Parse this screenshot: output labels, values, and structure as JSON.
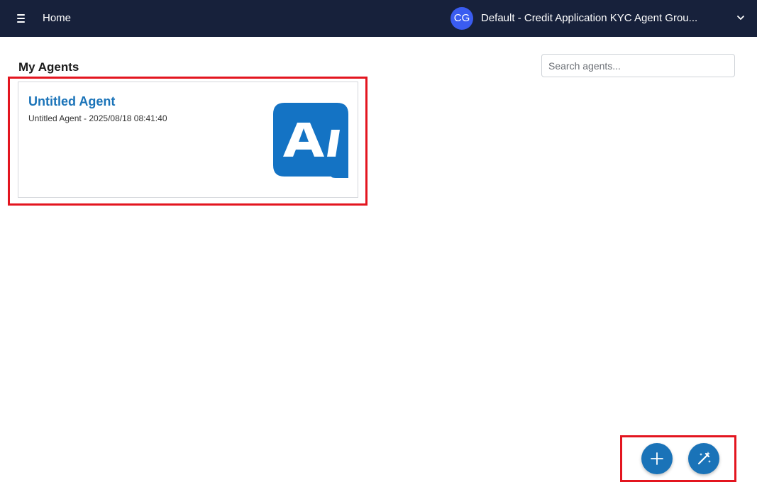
{
  "header": {
    "menu_icon": "hamburger-menu-icon",
    "title": "Home",
    "avatar_initials": "CG",
    "workspace_name": "Default - Credit Application KYC Agent Grou...",
    "dropdown_icon": "chevron-down-icon"
  },
  "main": {
    "section_title": "My Agents",
    "search": {
      "placeholder": "Search agents...",
      "value": ""
    },
    "agents": [
      {
        "name": "Untitled Agent",
        "meta": "Untitled Agent - 2025/08/18 08:41:40",
        "logo_text": "AI",
        "logo_color": "#1473c4"
      }
    ]
  },
  "actions": {
    "add_icon": "plus-icon",
    "magic_icon": "magic-wand-icon"
  },
  "colors": {
    "header_bg": "#17213b",
    "accent": "#1a73b8",
    "avatar_bg": "#3a5cf0",
    "highlight": "#e3151f"
  }
}
